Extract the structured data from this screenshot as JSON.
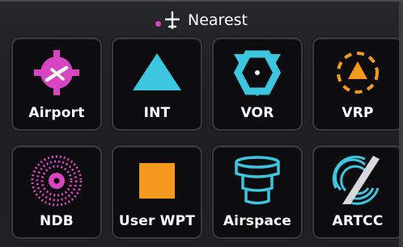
{
  "header": {
    "title": "Nearest",
    "icon": "airplane-icon"
  },
  "tiles": [
    {
      "label": "Airport",
      "icon": "airport-icon"
    },
    {
      "label": "INT",
      "icon": "intersection-icon"
    },
    {
      "label": "VOR",
      "icon": "vor-icon"
    },
    {
      "label": "VRP",
      "icon": "vrp-icon"
    },
    {
      "label": "NDB",
      "icon": "ndb-icon"
    },
    {
      "label": "User WPT",
      "icon": "user-waypoint-icon"
    },
    {
      "label": "Airspace",
      "icon": "airspace-icon"
    },
    {
      "label": "ARTCC",
      "icon": "artcc-icon"
    }
  ],
  "colors": {
    "magenta": "#d845c3",
    "cyan": "#3cc6e0",
    "orange": "#f39a1e"
  }
}
